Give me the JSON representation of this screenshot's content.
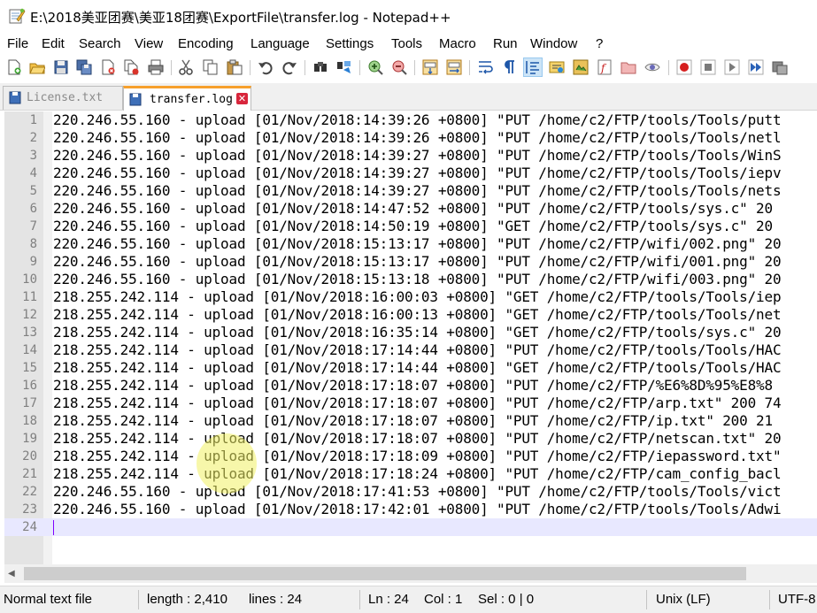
{
  "window": {
    "title": "E:\\2018美亚团赛\\美亚18团赛\\ExportFile\\transfer.log - Notepad++"
  },
  "menu": [
    "File",
    "Edit",
    "Search",
    "View",
    "Encoding",
    "Language",
    "Settings",
    "Tools",
    "Macro",
    "Run",
    "Window",
    "?"
  ],
  "toolbar": {
    "buttons": [
      "new-file",
      "open-file",
      "save",
      "save-all",
      "close",
      "close-all",
      "print",
      "cut",
      "copy",
      "paste",
      "undo",
      "redo",
      "find",
      "replace",
      "zoom-in",
      "zoom-out",
      "sync-vertical",
      "sync-horizontal",
      "word-wrap",
      "show-all-characters",
      "indent-guide",
      "user-defined-language",
      "document-map",
      "function-list",
      "folder-as-workspace",
      "monitoring",
      "record-macro",
      "stop-recording",
      "playback-macro",
      "run-macro-multiple",
      "save-macro"
    ]
  },
  "tabs": [
    {
      "label": "License.txt",
      "active": false
    },
    {
      "label": "transfer.log",
      "active": true
    }
  ],
  "editor": {
    "lines": [
      "220.246.55.160 - upload [01/Nov/2018:14:39:26 +0800] \"PUT /home/c2/FTP/tools/Tools/putt",
      "220.246.55.160 - upload [01/Nov/2018:14:39:26 +0800] \"PUT /home/c2/FTP/tools/Tools/netl",
      "220.246.55.160 - upload [01/Nov/2018:14:39:27 +0800] \"PUT /home/c2/FTP/tools/Tools/WinS",
      "220.246.55.160 - upload [01/Nov/2018:14:39:27 +0800] \"PUT /home/c2/FTP/tools/Tools/iepv",
      "220.246.55.160 - upload [01/Nov/2018:14:39:27 +0800] \"PUT /home/c2/FTP/tools/Tools/nets",
      "220.246.55.160 - upload [01/Nov/2018:14:47:52 +0800] \"PUT /home/c2/FTP/tools/sys.c\" 20",
      "220.246.55.160 - upload [01/Nov/2018:14:50:19 +0800] \"GET /home/c2/FTP/tools/sys.c\" 20",
      "220.246.55.160 - upload [01/Nov/2018:15:13:17 +0800] \"PUT /home/c2/FTP/wifi/002.png\" 20",
      "220.246.55.160 - upload [01/Nov/2018:15:13:17 +0800] \"PUT /home/c2/FTP/wifi/001.png\" 20",
      "220.246.55.160 - upload [01/Nov/2018:15:13:18 +0800] \"PUT /home/c2/FTP/wifi/003.png\" 20",
      "218.255.242.114 - upload [01/Nov/2018:16:00:03 +0800] \"GET /home/c2/FTP/tools/Tools/iep",
      "218.255.242.114 - upload [01/Nov/2018:16:00:13 +0800] \"GET /home/c2/FTP/tools/Tools/net",
      "218.255.242.114 - upload [01/Nov/2018:16:35:14 +0800] \"GET /home/c2/FTP/tools/sys.c\" 20",
      "218.255.242.114 - upload [01/Nov/2018:17:14:44 +0800] \"PUT /home/c2/FTP/tools/Tools/HAC",
      "218.255.242.114 - upload [01/Nov/2018:17:14:44 +0800] \"GET /home/c2/FTP/tools/Tools/HAC",
      "218.255.242.114 - upload [01/Nov/2018:17:18:07 +0800] \"PUT /home/c2/FTP/%E6%8D%95%E8%8",
      "218.255.242.114 - upload [01/Nov/2018:17:18:07 +0800] \"PUT /home/c2/FTP/arp.txt\" 200 74",
      "218.255.242.114 - upload [01/Nov/2018:17:18:07 +0800] \"PUT /home/c2/FTP/ip.txt\" 200 21",
      "218.255.242.114 - upload [01/Nov/2018:17:18:07 +0800] \"PUT /home/c2/FTP/netscan.txt\" 20",
      "218.255.242.114 - upload [01/Nov/2018:17:18:09 +0800] \"PUT /home/c2/FTP/iepassword.txt\"",
      "218.255.242.114 - upload [01/Nov/2018:17:18:24 +0800] \"PUT /home/c2/FTP/cam_config_bacl",
      "220.246.55.160 - upload [01/Nov/2018:17:41:53 +0800] \"PUT /home/c2/FTP/tools/Tools/vict",
      "220.246.55.160 - upload [01/Nov/2018:17:42:01 +0800] \"PUT /home/c2/FTP/tools/Tools/Adwi",
      ""
    ],
    "current_line": 24
  },
  "status": {
    "file_type": "Normal text file",
    "length": "length : 2,410",
    "lines": "lines : 24",
    "ln": "Ln : 24",
    "col": "Col : 1",
    "sel": "Sel : 0 | 0",
    "eol": "Unix (LF)",
    "encoding": "UTF-8"
  }
}
